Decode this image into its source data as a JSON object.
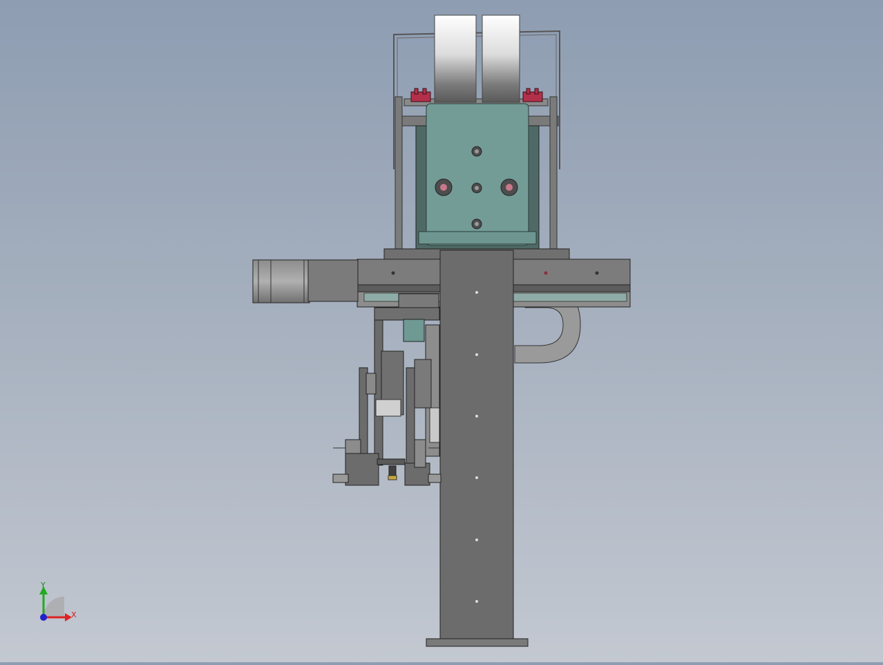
{
  "triad": {
    "y_label": "Y",
    "x_label": "X",
    "y_color": "#22aa22",
    "x_color": "#dd2222",
    "origin_color": "#2222cc"
  },
  "colors": {
    "metal": "#6e6e6e",
    "metal_light": "#8a8a8a",
    "teal": "#6f9c96",
    "accent": "#c8324a"
  }
}
